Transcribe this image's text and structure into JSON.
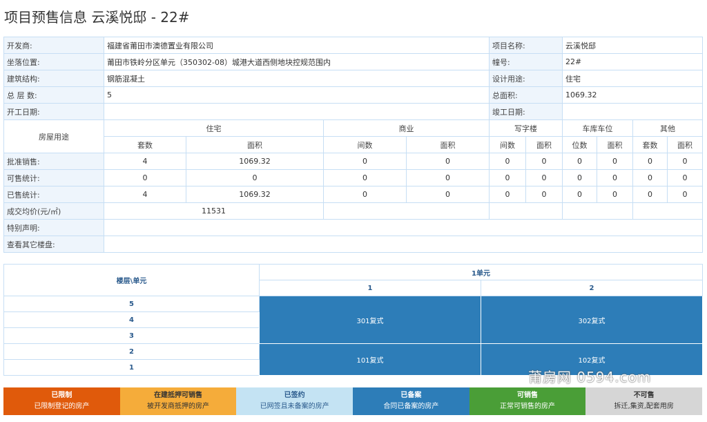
{
  "title": "项目预售信息 云溪悦邸 - 22#",
  "info": {
    "developer_label": "开发商:",
    "developer": "福建省莆田市澳德置业有限公司",
    "project_label": "项目名称:",
    "project": "云溪悦邸",
    "location_label": "坐落位置:",
    "location": "莆田市铁岭分区单元（350302-08）城港大道西侧地块控规范围内",
    "building_label": "幢号:",
    "building": "22#",
    "structure_label": "建筑结构:",
    "structure": "钢筋混凝土",
    "use_label": "设计用途:",
    "use": "住宅",
    "floors_label": "总 层 数:",
    "floors": "5",
    "area_label": "总面积:",
    "area": "1069.32",
    "start_label": "开工日期:",
    "start": "",
    "finish_label": "竣工日期:",
    "finish": ""
  },
  "stats": {
    "usage_label": "房屋用途",
    "categories": [
      "住宅",
      "商业",
      "写字楼",
      "车库车位",
      "其他"
    ],
    "subheaders": [
      "套数",
      "面积",
      "间数",
      "面积",
      "间数",
      "面积",
      "位数",
      "面积",
      "套数",
      "面积"
    ],
    "rows": [
      {
        "label": "批准销售:",
        "values": [
          "4",
          "1069.32",
          "0",
          "0",
          "0",
          "0",
          "0",
          "0",
          "0",
          "0"
        ]
      },
      {
        "label": "可售统计:",
        "values": [
          "0",
          "0",
          "0",
          "0",
          "0",
          "0",
          "0",
          "0",
          "0",
          "0"
        ]
      },
      {
        "label": "已售统计:",
        "values": [
          "4",
          "1069.32",
          "0",
          "0",
          "0",
          "0",
          "0",
          "0",
          "0",
          "0"
        ]
      }
    ],
    "avg_price_label": "成交均价(元/㎡)",
    "avg_price": "11531",
    "special_label": "特别声明:",
    "special": "",
    "others_label": "查看其它楼盘:",
    "others": ""
  },
  "floor_table": {
    "header": "楼层\\单元",
    "unit": "1单元",
    "columns": [
      "1",
      "2"
    ],
    "floors": [
      "5",
      "4",
      "3",
      "2",
      "1"
    ],
    "rooms": [
      "301复式",
      "302复式",
      "101复式",
      "102复式"
    ],
    "room_color": "#2d7db8"
  },
  "legend": [
    {
      "title": "已限制",
      "desc": "已限制登记的房产",
      "bg": "#e05a0b",
      "fg": "#ffffff"
    },
    {
      "title": "在建抵押可销售",
      "desc": "被开发商抵押的房产",
      "bg": "#f5ac3a",
      "fg": "#333333"
    },
    {
      "title": "已签约",
      "desc": "已网签且未备案的房产",
      "bg": "#c4e3f3",
      "fg": "#2a5a8c"
    },
    {
      "title": "已备案",
      "desc": "合同已备案的房产",
      "bg": "#2d7db8",
      "fg": "#ffffff"
    },
    {
      "title": "可销售",
      "desc": "正常可销售的房产",
      "bg": "#4a9e37",
      "fg": "#ffffff"
    },
    {
      "title": "不可售",
      "desc": "拆迁,集资,配套用房",
      "bg": "#d6d6d6",
      "fg": "#333333"
    }
  ],
  "watermark": "莆房网 0594.com"
}
